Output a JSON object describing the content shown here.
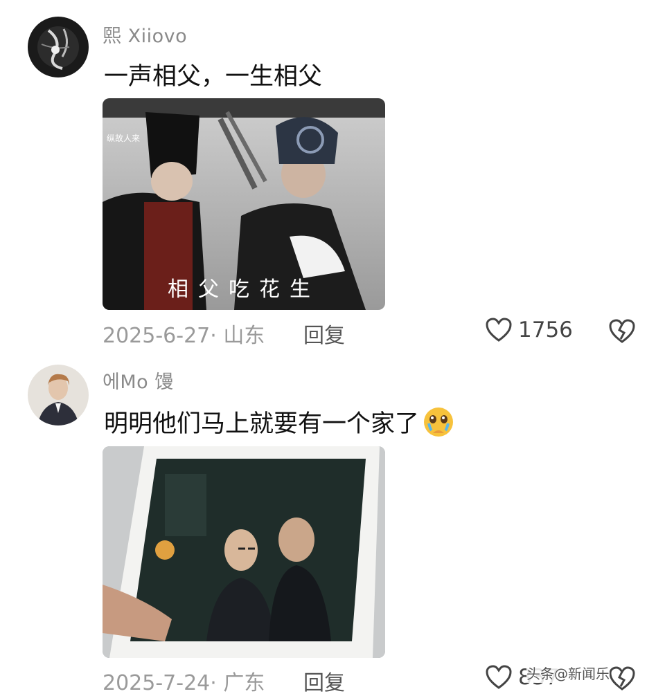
{
  "comments": [
    {
      "username": "熙 Xiiovo",
      "text": "一声相父，一生相父",
      "image_caption": "相父吃花生",
      "image_corner_text": "纵故人来",
      "meta": "2025-6-27· 山东",
      "reply_label": "回复",
      "likes": "1756",
      "avatar_icon": "dark-abstract-avatar",
      "like_icon": "heart-outline-icon",
      "dislike_icon": "broken-heart-icon"
    },
    {
      "username": "에Mo 馒",
      "text": "明明他们马上就要有一个家了",
      "emoji": "crying-face-emoji",
      "meta": "2025-7-24· 广东",
      "reply_label": "回复",
      "likes": "837",
      "avatar_icon": "person-photo-avatar",
      "like_icon": "heart-outline-icon",
      "dislike_icon": "broken-heart-icon"
    }
  ],
  "watermark": "头条@新闻乐",
  "colors": {
    "text": "#111111",
    "username": "#8a8a8a",
    "meta": "#9a9a9a",
    "icon": "#444444"
  }
}
